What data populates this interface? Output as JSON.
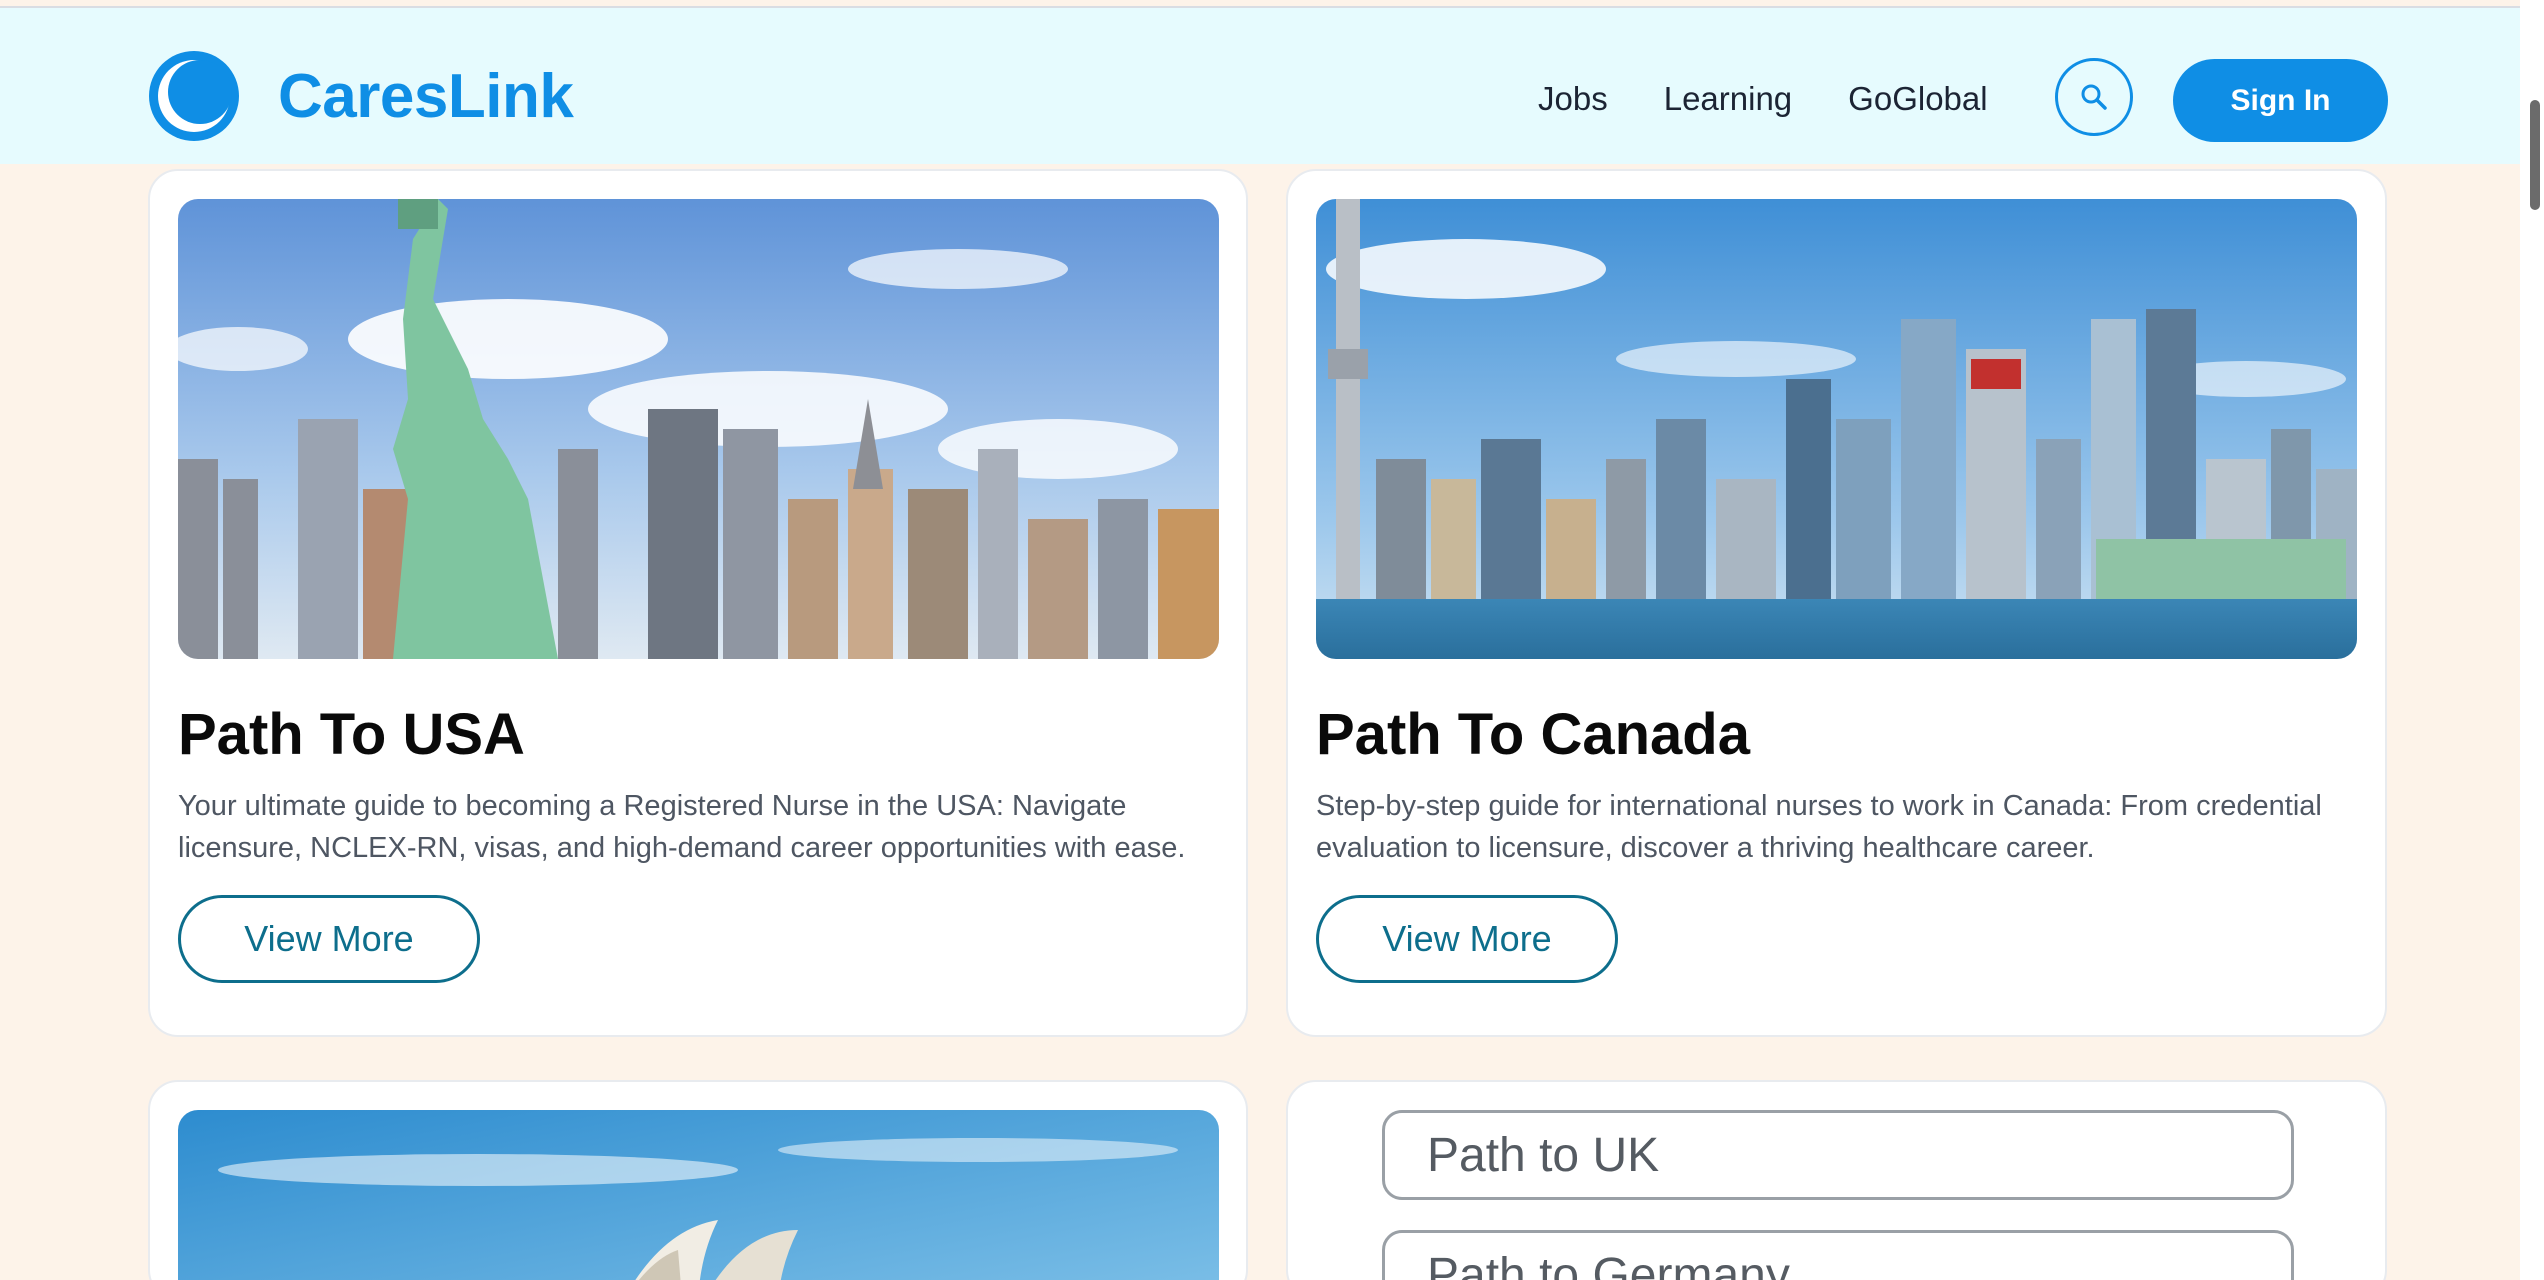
{
  "brand": {
    "name": "CaresLink",
    "color": "#0f8ee5"
  },
  "nav": {
    "links": [
      "Jobs",
      "Learning",
      "GoGlobal"
    ],
    "search_icon": "search-icon",
    "signin_label": "Sign In"
  },
  "cards": [
    {
      "title": "Path To USA",
      "description": "Your ultimate guide to becoming a Registered Nurse in the USA: Navigate licensure, NCLEX-RN, visas, and high-demand career opportunities with ease.",
      "button": "View More",
      "image": "new-york-skyline-statue-of-liberty"
    },
    {
      "title": "Path To Canada",
      "description": "Step-by-step guide for international nurses to work in Canada: From credential evaluation to licensure, discover a thriving healthcare career.",
      "button": "View More",
      "image": "toronto-skyline-cn-tower"
    }
  ],
  "bottom": {
    "image": "sydney-opera-house",
    "paths": [
      "Path to UK",
      "Path to Germany"
    ]
  }
}
